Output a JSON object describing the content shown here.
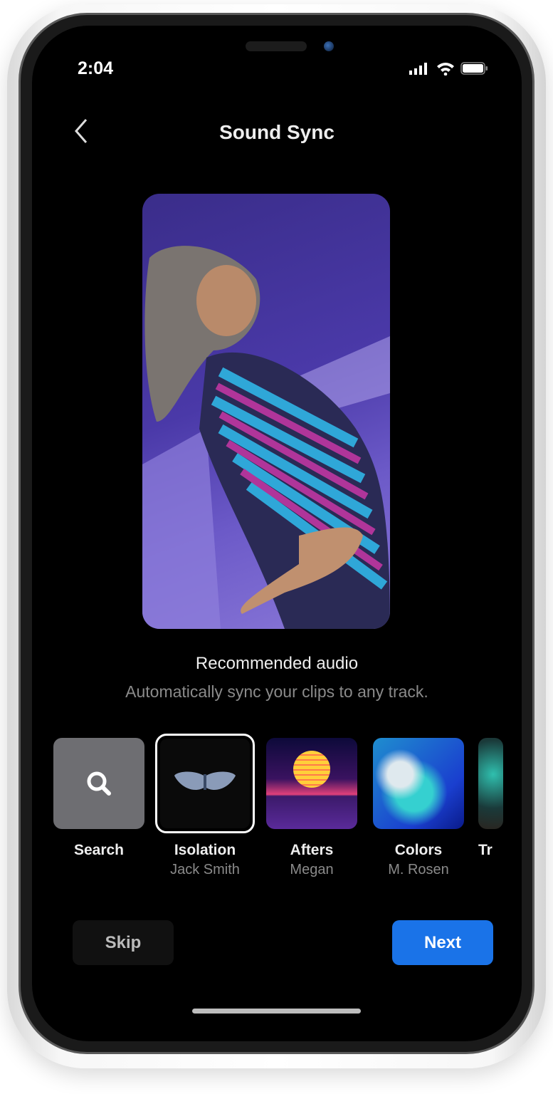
{
  "status_bar": {
    "time": "2:04"
  },
  "header": {
    "title": "Sound Sync",
    "back_icon": "chevron-left-icon"
  },
  "preview": {
    "description_icon": "photo-preview"
  },
  "section": {
    "title": "Recommended audio",
    "subtitle": "Automatically sync your clips to any track."
  },
  "tracks": [
    {
      "title": "Search",
      "artist": ""
    },
    {
      "title": "Isolation",
      "artist": "Jack Smith",
      "selected": true
    },
    {
      "title": "Afters",
      "artist": "Megan"
    },
    {
      "title": "Colors",
      "artist": "M. Rosen"
    },
    {
      "title": "Tr",
      "artist": ""
    }
  ],
  "actions": {
    "skip": "Skip",
    "next": "Next"
  },
  "colors": {
    "accent": "#1a73e8",
    "background": "#000000"
  }
}
